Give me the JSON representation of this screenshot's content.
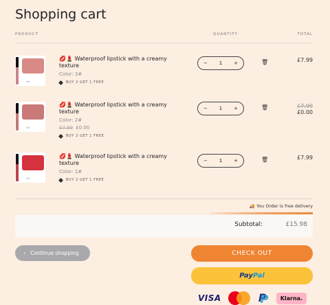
{
  "page": {
    "title": "Shopping cart"
  },
  "columns": {
    "product": "PRODUCT",
    "quantity": "QUANTITY",
    "total": "TOTAL"
  },
  "items": [
    {
      "name": "Waterproof lipstick with a creamy texture",
      "emoji": "💋💄",
      "variant": "Color: 3#",
      "promo": "BUY 2 GET 1 FREE",
      "quantity": "1",
      "total": "£7.99",
      "shade_code": "3#",
      "lip_color": "#d98a86",
      "stick_color": "#c9868a"
    },
    {
      "name": "Waterproof lipstick with a creamy texture",
      "emoji": "💋💄",
      "variant": "Color: 2#",
      "price_original": "£7.99",
      "price_current": "£0.00",
      "promo": "BUY 2 GET 1 FREE",
      "quantity": "1",
      "total_original": "£7.99",
      "total": "£0.00",
      "shade_code": "2#",
      "lip_color": "#c97a78",
      "stick_color": "#c27a78"
    },
    {
      "name": "Waterproof lipstick with a creamy texture",
      "emoji": "💋💄",
      "variant": "Color: 1#",
      "promo": "BUY 2 GET 1 FREE",
      "quantity": "1",
      "total": "£7.99",
      "shade_code": "1#",
      "lip_color": "#d4323e",
      "stick_color": "#b84550"
    }
  ],
  "delivery": {
    "text": "You Order is free delivery",
    "progress": 1.0
  },
  "subtotal": {
    "label": "Subtotal:",
    "value": "£15.98"
  },
  "buttons": {
    "continue": "Continue shopping",
    "checkout": "CHECK OUT",
    "paypal_1": "Pay",
    "paypal_2": "Pal"
  },
  "payment_methods": {
    "visa": "VISA",
    "klarna": "Klarna."
  },
  "icons": {
    "decrement": "minus-icon",
    "increment": "plus-icon",
    "remove": "trash-icon",
    "delivery": "truck-icon",
    "promo": "tag-icon",
    "back": "chevron-left-icon"
  },
  "colors": {
    "checkout": "#ef8433",
    "paypal": "#fcc23a",
    "continue": "#a9a9ad",
    "background": "#fdeee2"
  }
}
